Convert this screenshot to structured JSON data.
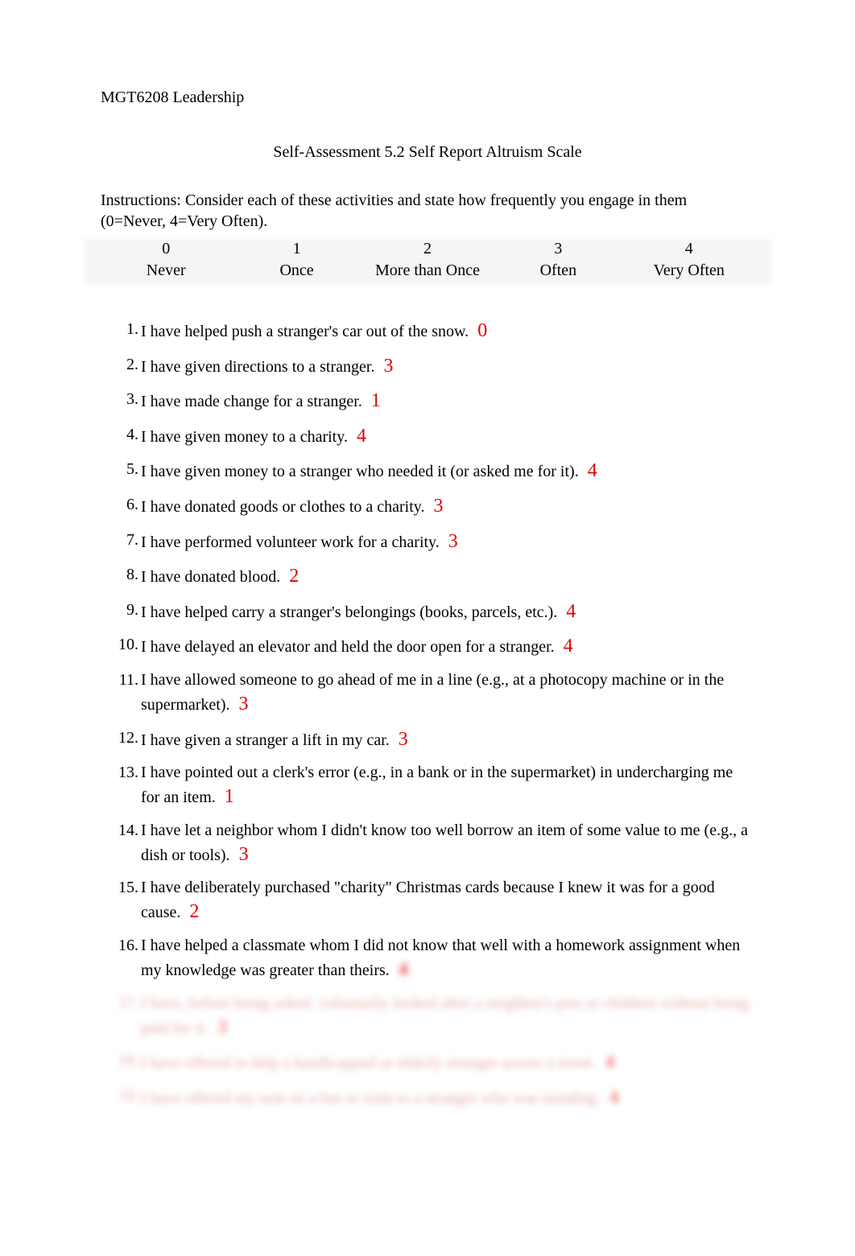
{
  "courseHeader": "MGT6208 Leadership",
  "title": "Self-Assessment 5.2 Self Report Altruism Scale",
  "instructions": "Instructions: Consider each of these activities and state how frequently you engage in them (0=Never, 4=Very Often).",
  "scale": {
    "numbers": [
      "0",
      "1",
      "2",
      "3",
      "4"
    ],
    "labels": [
      "Never",
      "Once",
      "More than Once",
      "Often",
      "Very Often"
    ]
  },
  "questions": [
    {
      "text": "I have helped push a stranger's car out of the snow.",
      "answer": "0",
      "blurred": false
    },
    {
      "text": "I have given directions to a stranger.",
      "answer": "3",
      "blurred": false
    },
    {
      "text": "I have made change for a stranger.",
      "answer": "1",
      "blurred": false
    },
    {
      "text": "I have given money to a charity.",
      "answer": "4",
      "blurred": false
    },
    {
      "text": "I have given money to a stranger who needed it (or asked me for it).",
      "answer": "4",
      "blurred": false
    },
    {
      "text": "I have donated goods or clothes to a charity.",
      "answer": "3",
      "blurred": false
    },
    {
      "text": "I have performed volunteer work for a charity.",
      "answer": "3",
      "blurred": false
    },
    {
      "text": "I have donated blood.",
      "answer": "2",
      "blurred": false
    },
    {
      "text": "I have helped carry a stranger's belongings (books, parcels, etc.).",
      "answer": "4",
      "blurred": false
    },
    {
      "text": "I have delayed an elevator and held the door open for a stranger.",
      "answer": "4",
      "blurred": false
    },
    {
      "text": "I have allowed someone to go ahead of me in a line (e.g., at a photocopy machine or in the supermarket).",
      "answer": "3",
      "blurred": false
    },
    {
      "text": "I have given a stranger a lift in my car.",
      "answer": "3",
      "blurred": false
    },
    {
      "text": "I have pointed out a clerk's error (e.g., in a bank or in the supermarket) in undercharging me for an item.",
      "answer": "1",
      "blurred": false
    },
    {
      "text": "I have let a neighbor whom I didn't know too well borrow an item of some value to me (e.g., a dish or tools).",
      "answer": "3",
      "blurred": false
    },
    {
      "text": "I have deliberately purchased \"charity\" Christmas cards because I knew it was for a good cause.",
      "answer": "2",
      "blurred": false
    },
    {
      "text": "I have helped a classmate whom I did not know that well with a homework assignment when my knowledge was greater than theirs.",
      "answer": "4",
      "blurred": false,
      "answerBlurred": true
    },
    {
      "text": "I have, before being asked, voluntarily looked after a neighbor's pets or children without being paid for it.",
      "answer": "3",
      "blurred": true
    },
    {
      "text": "I have offered to help a handicapped or elderly stranger across a street.",
      "answer": "4",
      "blurred": true
    },
    {
      "text": "I have offered my seat on a bus or train to a stranger who was standing.",
      "answer": "4",
      "blurred": true
    }
  ]
}
